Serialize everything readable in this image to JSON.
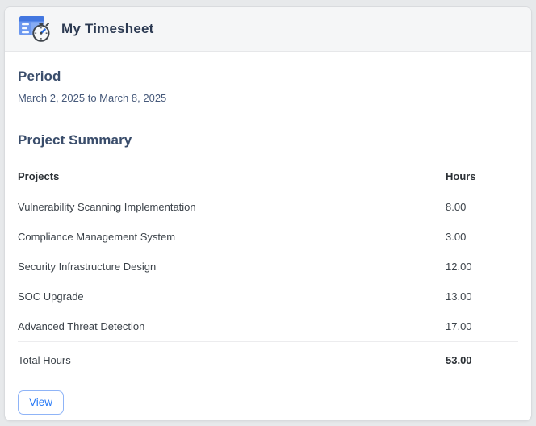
{
  "header": {
    "title": "My Timesheet",
    "icon": "timesheet-clock-icon"
  },
  "period": {
    "heading": "Period",
    "value": "March 2, 2025 to March 8, 2025"
  },
  "summary": {
    "heading": "Project Summary",
    "table": {
      "columns": [
        "Projects",
        "Hours"
      ],
      "rows": [
        {
          "project": "Vulnerability Scanning Implementation",
          "hours": "8.00"
        },
        {
          "project": "Compliance Management System",
          "hours": "3.00"
        },
        {
          "project": "Security Infrastructure Design",
          "hours": "12.00"
        },
        {
          "project": "SOC Upgrade",
          "hours": "13.00"
        },
        {
          "project": "Advanced Threat Detection",
          "hours": "17.00"
        }
      ],
      "total": {
        "label": "Total Hours",
        "value": "53.00"
      }
    }
  },
  "actions": {
    "view_label": "View"
  },
  "colors": {
    "accent_blue": "#2779f6",
    "button_border": "#8fb4f7",
    "title_navy": "#2c3a52",
    "heading_slate": "#3a4d6b",
    "icon_blue": "#5b8cee",
    "card_header_bg": "#f5f6f7",
    "page_background": "#e7e9eb"
  }
}
